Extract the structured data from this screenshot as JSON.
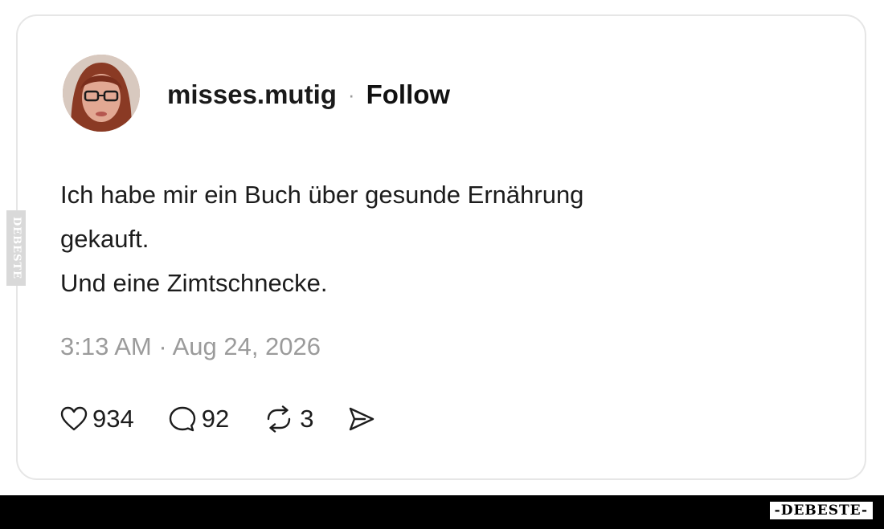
{
  "post": {
    "username": "misses.mutig",
    "separator": "·",
    "follow_label": "Follow",
    "text_lines": [
      "Ich habe mir ein Buch über gesunde Ernährung",
      "gekauft.",
      "Und eine Zimtschnecke."
    ],
    "timestamp": "3:13 AM · Aug 24, 2026",
    "actions": {
      "likes": "934",
      "replies": "92",
      "reposts": "3"
    },
    "icons": {
      "like": "heart-icon",
      "reply": "speech-bubble-icon",
      "repost": "repost-icon",
      "share": "send-icon"
    }
  },
  "watermark": {
    "side": "DEBESTE",
    "brand": "-DEBESTE-"
  },
  "colors": {
    "text": "#1c1c1c",
    "muted": "#9b9b9b",
    "card_border": "#e6e6e6",
    "bottom_bar": "#000000"
  }
}
